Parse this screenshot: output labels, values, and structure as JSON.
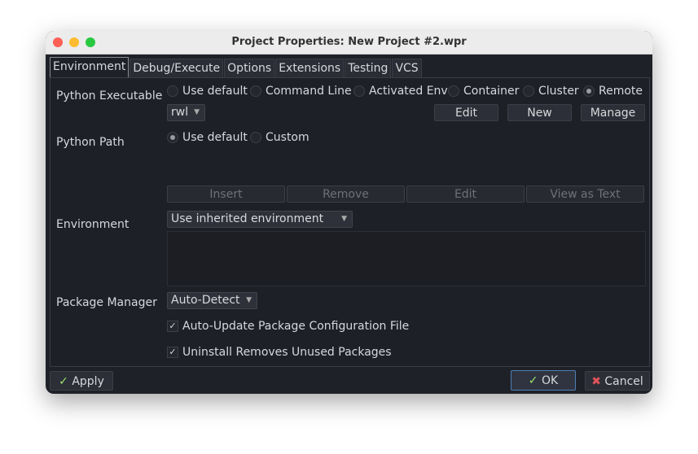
{
  "window": {
    "title": "Project Properties: New Project #2.wpr"
  },
  "tabs": [
    "Environment",
    "Debug/Execute",
    "Options",
    "Extensions",
    "Testing",
    "VCS"
  ],
  "python_executable": {
    "label": "Python Executable",
    "options": [
      "Use default",
      "Command Line",
      "Activated Env",
      "Container",
      "Cluster",
      "Remote"
    ],
    "selected": "Remote",
    "combo_value": "rwl",
    "buttons": [
      "Edit",
      "New",
      "Manage"
    ]
  },
  "python_path": {
    "label": "Python Path",
    "options": [
      "Use default",
      "Custom"
    ],
    "selected": "Use default"
  },
  "environment": {
    "label": "Environment",
    "buttons": [
      "Insert",
      "Remove",
      "Edit",
      "View as Text"
    ],
    "combo_value": "Use inherited environment"
  },
  "package_manager": {
    "label": "Package Manager",
    "combo_value": "Auto-Detect"
  },
  "checkboxes": [
    {
      "label": "Auto-Update Package Configuration File",
      "checked": true
    },
    {
      "label": "Uninstall Removes Unused Packages",
      "checked": true
    }
  ],
  "footer": {
    "apply": "Apply",
    "ok": "OK",
    "cancel": "Cancel"
  },
  "colors": {
    "check_green": "#9be36a",
    "cancel_red": "#e0525a",
    "ok_border": "#4f7fb5"
  }
}
